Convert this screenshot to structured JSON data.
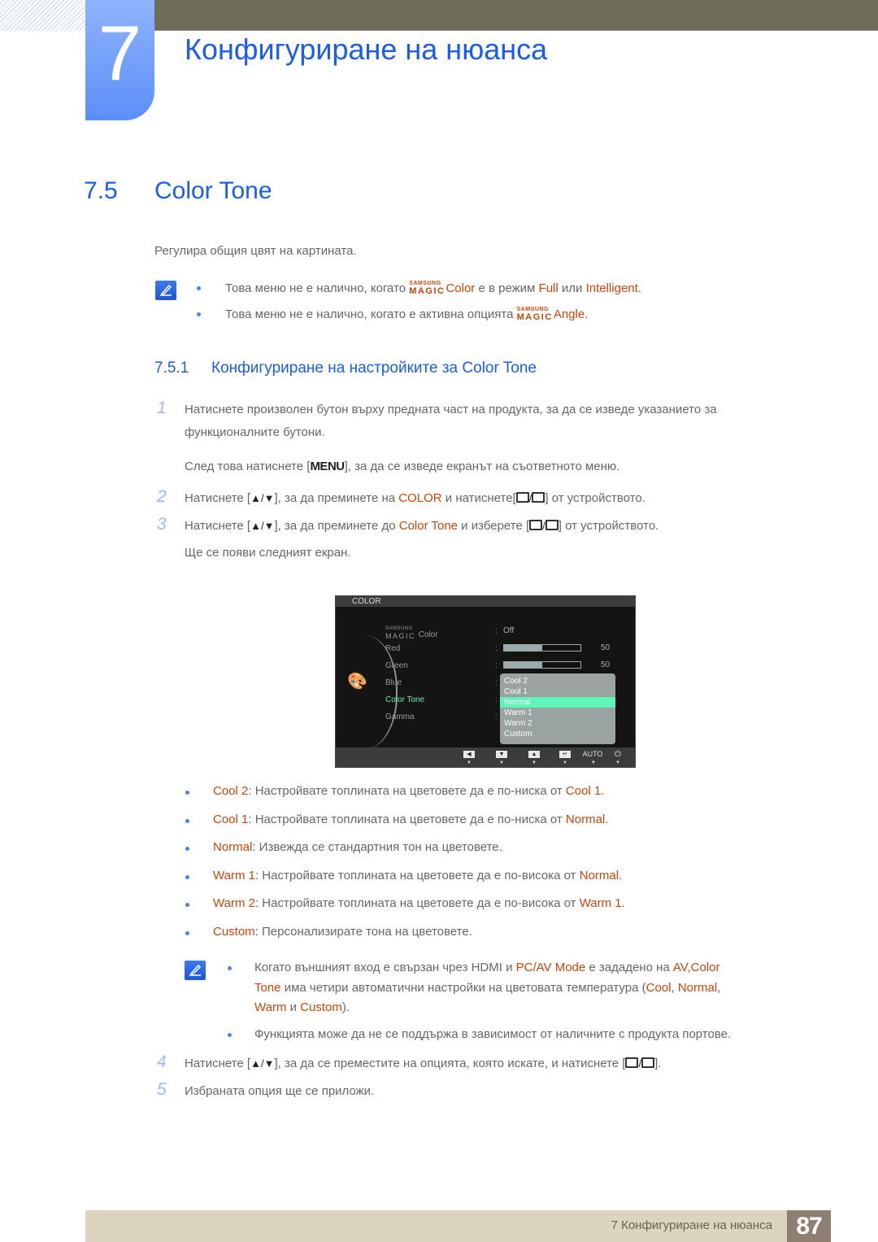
{
  "header": {
    "chapter_number": "7",
    "chapter_title": "Конфигуриране на нюанса"
  },
  "section": {
    "number": "7.5",
    "title": "Color Tone",
    "intro": "Регулира общия цвят на картината."
  },
  "notes_top": [
    {
      "pre": "Това меню не е налично, когато ",
      "magic_small": "SAMSUNG",
      "magic_big": "MAGIC",
      "magic_word": "Color",
      "mid": " е в режим ",
      "hl1": "Full",
      "mid2": " или ",
      "hl2": "Intelligent",
      "post": "."
    },
    {
      "pre": "Това меню не е налично, когато е активна опцията ",
      "magic_small": "SAMSUNG",
      "magic_big": "MAGIC",
      "magic_word": "Angle",
      "post": "."
    }
  ],
  "subsection": {
    "number": "7.5.1",
    "title": "Конфигуриране на настройките за Color Tone"
  },
  "steps": [
    {
      "num": "1",
      "line1": "Натиснете произволен бутон върху предната част на продукта, за да се изведе указанието за",
      "line2": "функционалните бутони.",
      "line3_pre": "След това натиснете [",
      "line3_key": "MENU",
      "line3_post": "], за да се изведе екранът на съответното меню."
    },
    {
      "num": "2",
      "pre": "Натиснете [",
      "keys": "▲/▼",
      "mid": "], за да преминете на ",
      "hl": "COLOR",
      "mid2": " и натиснете[",
      "post": "] от устройството."
    },
    {
      "num": "3",
      "pre": "Натиснете [",
      "keys": "▲/▼",
      "mid": "], за да преминете до ",
      "hl": "Color Tone",
      "mid2": " и изберете [",
      "post": "] от устройството.",
      "line2": "Ще се появи следният екран."
    },
    {
      "num": "4",
      "pre": "Натиснете [",
      "keys": "▲/▼",
      "mid": "], за да се преместите на опцията, която искате, и натиснете [",
      "post": "]."
    },
    {
      "num": "5",
      "text": "Избраната опция ще се приложи."
    }
  ],
  "osd": {
    "title": "COLOR",
    "items": [
      {
        "label_small": "SAMSUNG",
        "label_big": "MAGIC",
        "label": "Color",
        "value": "Off"
      },
      {
        "label": "Red",
        "value_num": "50",
        "level": 0.5
      },
      {
        "label": "Green",
        "value_num": "50",
        "level": 0.5
      },
      {
        "label": "Blue"
      },
      {
        "label": "Color Tone",
        "active": true
      },
      {
        "label": "Gamma"
      }
    ],
    "options": [
      "Cool 2",
      "Cool 1",
      "Normal",
      "Warm 1",
      "Warm 2",
      "Custom"
    ],
    "selected_option": "Normal",
    "footer_buttons": [
      "left-arrow",
      "down-arrow",
      "up-arrow",
      "enter",
      "AUTO",
      "power"
    ],
    "auto_label": "AUTO",
    "colors": {
      "highlight": "#5ef5b8",
      "active_text": "#5ef0b0"
    }
  },
  "options_desc": [
    {
      "name": "Cool 2",
      "text": ": Настройвате топлината на цветовете да е по-ниска от ",
      "ref": "Cool 1",
      "end": "."
    },
    {
      "name": "Cool 1",
      "text": ": Настройвате топлината на цветовете да е по-ниска от ",
      "ref": "Normal",
      "end": "."
    },
    {
      "name": "Normal",
      "text": ": Извежда се стандартния тон на цветовете.",
      "ref": "",
      "end": ""
    },
    {
      "name": "Warm 1",
      "text": ": Настройвате топлината на цветовете да е по-висока от ",
      "ref": "Normal",
      "end": "."
    },
    {
      "name": "Warm 2",
      "text": ": Настройвате топлината на цветовете да е по-висока от ",
      "ref": "Warm 1",
      "end": "."
    },
    {
      "name": "Custom",
      "text": ": Персонализирате тона на цветовете.",
      "ref": "",
      "end": ""
    }
  ],
  "notes_bottom": {
    "n1_l1_pre": "Когато външният вход е свързан чрез HDMI и ",
    "n1_l1_hl1": "PC/AV Mode",
    "n1_l1_mid": " е зададено на ",
    "n1_l1_hl2": "AV",
    "n1_l1_comma": ",",
    "n1_l1_hl3": "Color",
    "n1_l2_hl": "Tone",
    "n1_l2_mid": " има четири автоматични настройки на цветовата температура (",
    "n1_l2_hl2": "Cool",
    "n1_l2_sep": ", ",
    "n1_l2_hl3": "Normal",
    "n1_l2_end": ",",
    "n1_l3_hl1": "Warm",
    "n1_l3_mid": " и ",
    "n1_l3_hl2": "Custom",
    "n1_l3_end": ").",
    "n2": "Функцията може да не се поддържа в зависимост от наличните с продукта портове."
  },
  "footer": {
    "text": "7 Конфигуриране на нюанса",
    "page": "87"
  },
  "colors": {
    "heading": "#1a5cf0",
    "highlight": "#c8460a",
    "topbar": "#6e6c5a",
    "footer_bg": "#dcd4bf",
    "page_num_bg": "#8e8070"
  }
}
